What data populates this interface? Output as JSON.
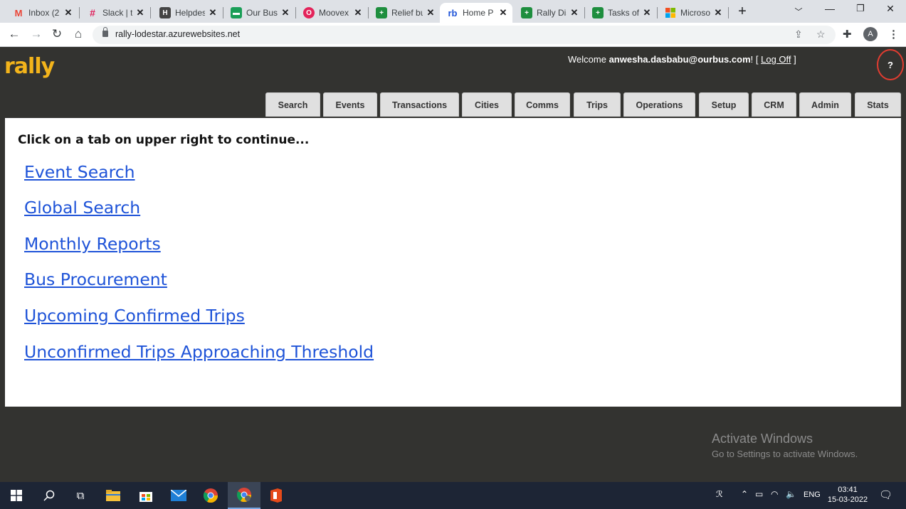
{
  "browser": {
    "tabs": [
      {
        "title": "Inbox (2",
        "icon": "gmail-icon",
        "color": "#ea4335",
        "glyph": "M"
      },
      {
        "title": "Slack | t",
        "icon": "slack-icon",
        "color": "#611f69",
        "glyph": "#"
      },
      {
        "title": "Helpdes",
        "icon": "helpdesk-icon",
        "color": "#333333",
        "glyph": "H"
      },
      {
        "title": "Our Bus",
        "icon": "ourbus-icon",
        "color": "#1a9e57",
        "glyph": "▬"
      },
      {
        "title": "Moovex",
        "icon": "moovex-icon",
        "color": "#e3235a",
        "glyph": "O"
      },
      {
        "title": "Relief bu",
        "icon": "sheets-icon",
        "color": "#1e8e3e",
        "glyph": "+"
      },
      {
        "title": "Home P",
        "icon": "rb-icon",
        "color": "#1e53d8",
        "glyph": "rb",
        "active": true
      },
      {
        "title": "Rally Dis",
        "icon": "sheets-icon",
        "color": "#1e8e3e",
        "glyph": "+"
      },
      {
        "title": "Tasks of",
        "icon": "sheets-icon",
        "color": "#1e8e3e",
        "glyph": "+"
      },
      {
        "title": "Microso",
        "icon": "microsoft-icon",
        "color": "#f25022",
        "glyph": "■"
      }
    ],
    "url": "rally-lodestar.azurewebsites.net",
    "profile_initial": "A"
  },
  "header": {
    "logo": "rally",
    "welcome_prefix": "Welcome",
    "user": "anwesha.dasbabu@ourbus.com",
    "after_user": "! [",
    "logoff": "Log Off",
    "close_bracket": "]",
    "help": "?"
  },
  "nav": [
    "Search",
    "Events",
    "Transactions",
    "Cities",
    "Comms",
    "Trips",
    "Operations",
    "Setup",
    "CRM",
    "Admin",
    "Stats"
  ],
  "main": {
    "prompt": "Click on a tab on upper right to continue...",
    "links": [
      "Event Search",
      "Global Search",
      "Monthly Reports",
      "Bus Procurement",
      "Upcoming Confirmed Trips",
      "Unconfirmed Trips Approaching Threshold"
    ]
  },
  "watermark": {
    "line1": "Activate Windows",
    "line2": "Go to Settings to activate Windows."
  },
  "taskbar": {
    "language": "ENG",
    "time": "03:41",
    "date": "15-03-2022"
  }
}
